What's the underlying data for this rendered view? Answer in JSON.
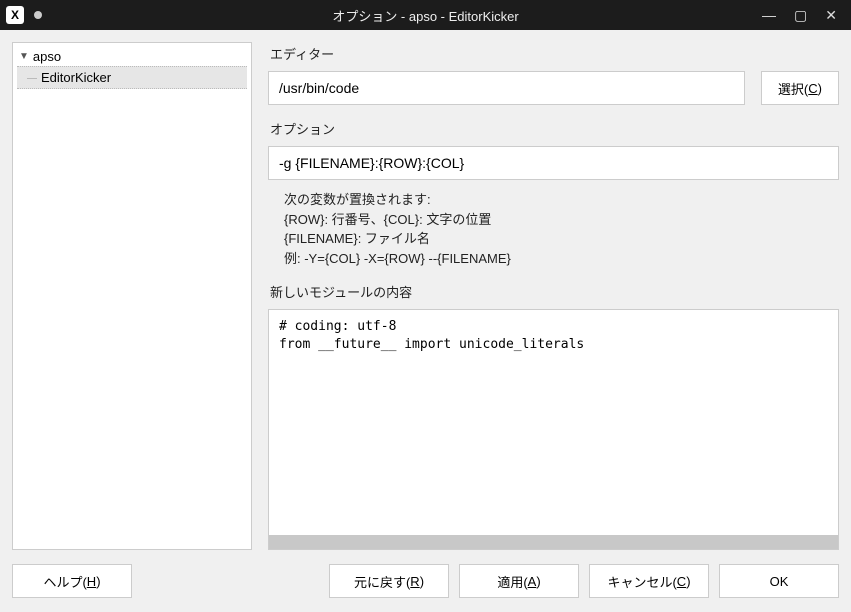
{
  "window": {
    "title": "オプション - apso - EditorKicker"
  },
  "sidebar": {
    "root": "apso",
    "child": "EditorKicker"
  },
  "editor": {
    "label": "エディター",
    "value": "/usr/bin/code",
    "select_label": "選択(",
    "select_accel": "C",
    "select_tail": ")"
  },
  "option": {
    "label": "オプション",
    "value": "-g {FILENAME}:{ROW}:{COL}",
    "desc_line1": "次の変数が置換されます:",
    "desc_line2": "{ROW}: 行番号、{COL}: 文字の位置",
    "desc_line3": "{FILENAME}: ファイル名",
    "desc_line4": "例: -Y={COL} -X={ROW} --{FILENAME}"
  },
  "module": {
    "label": "新しいモジュールの内容",
    "content": "# coding: utf-8\nfrom __future__ import unicode_literals"
  },
  "buttons": {
    "help": "ヘルプ(",
    "help_accel": "H",
    "help_tail": ")",
    "revert": "元に戻す(",
    "revert_accel": "R",
    "revert_tail": ")",
    "apply": "適用(",
    "apply_accel": "A",
    "apply_tail": ")",
    "cancel": "キャンセル(",
    "cancel_accel": "C",
    "cancel_tail": ")",
    "ok": "OK"
  }
}
